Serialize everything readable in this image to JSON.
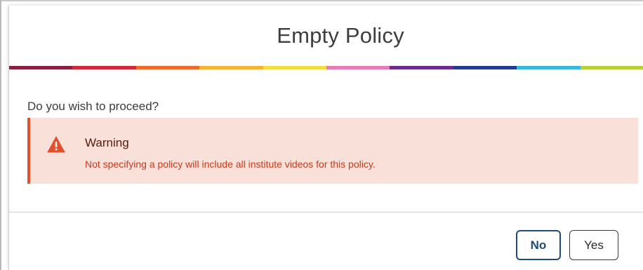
{
  "dialog": {
    "title": "Empty Policy",
    "question": "Do you wish to proceed?",
    "rainbow_colors": [
      "#8a1f3f",
      "#d4283b",
      "#ee6a2a",
      "#f6b233",
      "#f3df44",
      "#e67bb6",
      "#6b2a8c",
      "#233a8e",
      "#38b6de",
      "#b9cf3a"
    ],
    "warning": {
      "title": "Warning",
      "message": "Not specifying a policy will include all institute videos for this policy.",
      "icon": "warning-triangle-icon",
      "accent_color": "#e2502e",
      "background_color": "#f9e1d9"
    },
    "buttons": {
      "no_label": "No",
      "yes_label": "Yes"
    }
  }
}
